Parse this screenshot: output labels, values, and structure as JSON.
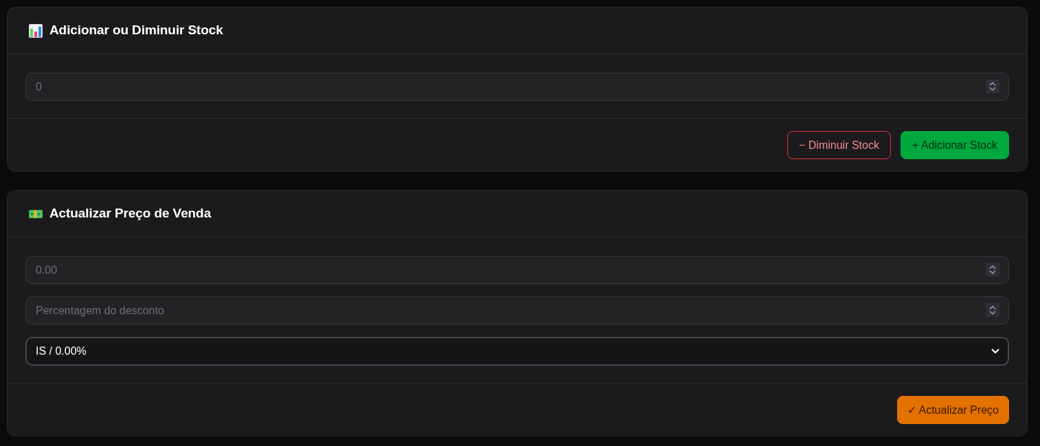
{
  "cards": [
    {
      "kind": "stock",
      "title": "Adicionar ou Diminuir Stock",
      "fields": [
        {
          "kind": "number",
          "placeholder": "0"
        }
      ],
      "buttons": [
        {
          "kind": "danger",
          "label": "− Diminuir Stock"
        },
        {
          "kind": "success",
          "label": "+ Adicionar Stock"
        }
      ]
    },
    {
      "kind": "price",
      "title": "Actualizar Preço de Venda",
      "fields": [
        {
          "kind": "number",
          "placeholder": "0.00"
        },
        {
          "kind": "number",
          "placeholder": "Percentagem do desconto"
        },
        {
          "kind": "select",
          "value": "IS / 0.00%"
        }
      ],
      "buttons": [
        {
          "kind": "warning",
          "label": "✓ Actualizar Preço"
        }
      ]
    }
  ]
}
